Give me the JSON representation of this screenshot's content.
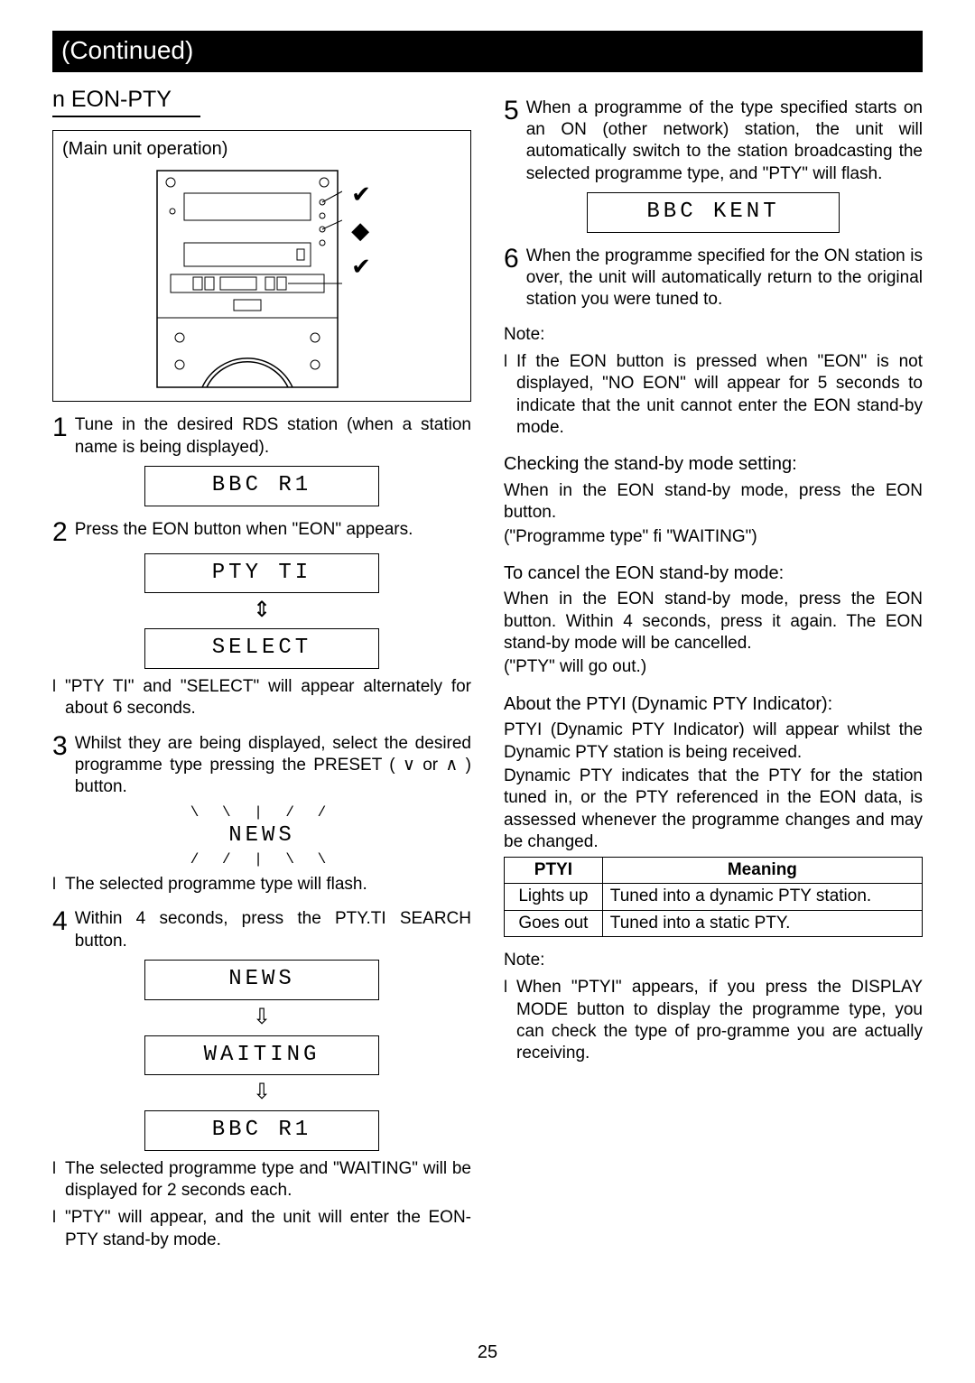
{
  "banner": "(Continued)",
  "section_title": "n EON-PTY",
  "illus_caption": "(Main unit operation)",
  "steps": {
    "s1": {
      "num": "1",
      "text": "Tune in the desired RDS station (when a station name is being displayed)."
    },
    "s2": {
      "num": "2",
      "text": "Press the EON button when \"EON\" appears."
    },
    "s3": {
      "num": "3",
      "text": "Whilst they are being displayed, select the desired programme type pressing the PRESET ( ∨ or ∧ ) button."
    },
    "s4": {
      "num": "4",
      "text": "Within 4 seconds, press the PTY.TI SEARCH button."
    },
    "s5": {
      "num": "5",
      "text": "When a programme of the type specified starts on an ON (other network) station, the unit will automatically switch to the station broadcasting the selected programme type, and \"PTY\" will flash."
    },
    "s6": {
      "num": "6",
      "text": "When the programme specified for the ON station is over, the unit will automatically return to the original station you were tuned to."
    }
  },
  "displays": {
    "bbc_r1": "BBC  R1",
    "pty_ti": "PTY  TI",
    "select": "SELECT",
    "news": "NEWS",
    "waiting": "WAITING",
    "bbc_kent": "BBC  KENT"
  },
  "bullets": {
    "b_s2": "\"PTY TI\" and \"SELECT\" will appear alternately for about 6 seconds.",
    "b_s3": "The selected programme type will flash.",
    "b_s4a": "The selected programme type and \"WAITING\" will be displayed for 2 seconds each.",
    "b_s4b": "\"PTY\" will appear, and the unit will enter the EON-PTY stand-by mode."
  },
  "right": {
    "note_label": "Note:",
    "note1": "If the EON button is pressed when \"EON\" is not displayed, \"NO EON\" will appear for 5 seconds to indicate that the unit cannot enter the EON stand-by mode.",
    "check_h": "Checking the stand-by mode setting:",
    "check_p1": "When in the EON stand-by mode, press the EON button.",
    "check_p2": "(\"Programme type\" fi  \"WAITING\")",
    "cancel_h": "To cancel the EON stand-by mode:",
    "cancel_p1": "When in the EON stand-by mode, press the EON button. Within 4 seconds, press it again. The EON stand-by mode will be cancelled.",
    "cancel_p2": "(\"PTY\" will go out.)",
    "ptyi_h": "About the PTYI (Dynamic PTY Indicator):",
    "ptyi_p1": "PTYI (Dynamic PTY Indicator) will appear whilst the Dynamic PTY station is being received.",
    "ptyi_p2": "Dynamic PTY indicates that the PTY for the station tuned in, or the PTY referenced in the EON data, is assessed whenever the programme changes and may be changed.",
    "note2": "When \"PTYI\" appears, if you press the DISPLAY MODE button to display the programme type, you can check the type of pro-gramme you are actually receiving."
  },
  "table": {
    "h1": "PTYI",
    "h2": "Meaning",
    "r1c1": "Lights up",
    "r1c2": "Tuned into a dynamic PTY station.",
    "r2c1": "Goes out",
    "r2c2": "Tuned into a static PTY."
  },
  "page_number": "25",
  "icons": {
    "check": "✔",
    "diamond": "◆",
    "arrow_down": "⇩",
    "arrow_updown": "⇕"
  }
}
